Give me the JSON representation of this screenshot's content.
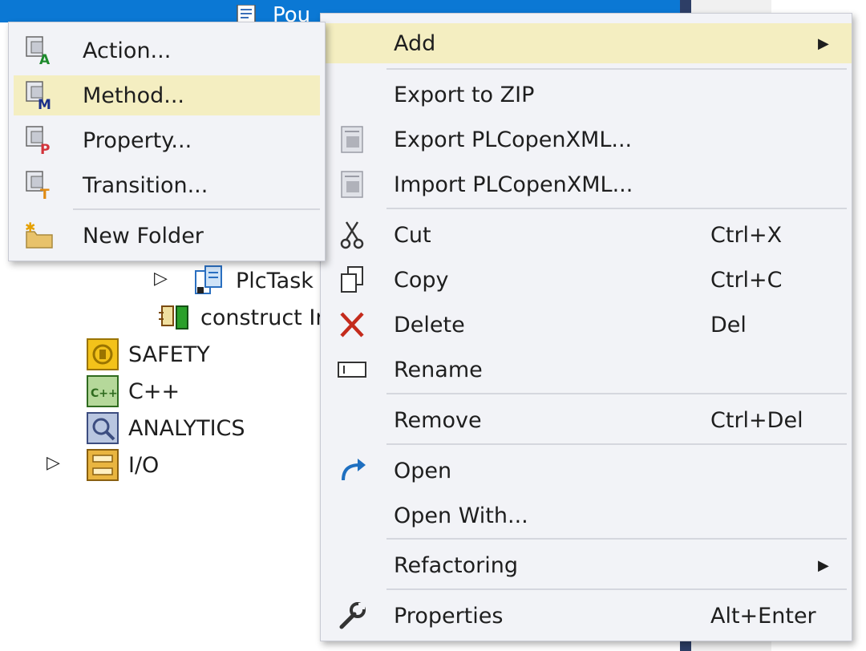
{
  "background": {
    "partial_title": "Pou",
    "colors": {
      "accent": "#0b78d4",
      "highlight": "#f4eec1",
      "menu_bg": "#f2f3f7"
    }
  },
  "tree": {
    "items": [
      {
        "label": "PlcTask",
        "icon": "task-icon",
        "expandable": true
      },
      {
        "label": "construct Ir",
        "icon": "construct-icon",
        "expandable": false
      },
      {
        "label": "SAFETY",
        "icon": "safety-icon",
        "expandable": false
      },
      {
        "label": "C++",
        "icon": "cpp-icon",
        "expandable": false
      },
      {
        "label": "ANALYTICS",
        "icon": "analytics-icon",
        "expandable": false
      },
      {
        "label": "I/O",
        "icon": "io-icon",
        "expandable": true
      }
    ]
  },
  "context_menu": {
    "items": [
      {
        "label": "Add",
        "shortcut": "",
        "icon": "",
        "submenu": true,
        "highlighted": true
      },
      {
        "label": "Export to ZIP",
        "shortcut": "",
        "icon": ""
      },
      {
        "label": "Export PLCopenXML...",
        "shortcut": "",
        "icon": "export-xml-icon"
      },
      {
        "label": "Import PLCopenXML...",
        "shortcut": "",
        "icon": "import-xml-icon"
      },
      {
        "label": "Cut",
        "shortcut": "Ctrl+X",
        "icon": "scissors-icon"
      },
      {
        "label": "Copy",
        "shortcut": "Ctrl+C",
        "icon": "copy-icon"
      },
      {
        "label": "Delete",
        "shortcut": "Del",
        "icon": "delete-x-icon"
      },
      {
        "label": "Rename",
        "shortcut": "",
        "icon": "rename-icon"
      },
      {
        "label": "Remove",
        "shortcut": "Ctrl+Del",
        "icon": ""
      },
      {
        "label": "Open",
        "shortcut": "",
        "icon": "open-arrow-icon"
      },
      {
        "label": "Open With...",
        "shortcut": "",
        "icon": ""
      },
      {
        "label": "Refactoring",
        "shortcut": "",
        "icon": "",
        "submenu": true
      },
      {
        "label": "Properties",
        "shortcut": "Alt+Enter",
        "icon": "wrench-icon"
      }
    ]
  },
  "add_submenu": {
    "items": [
      {
        "label": "Action...",
        "icon": "action-icon"
      },
      {
        "label": "Method...",
        "icon": "method-icon",
        "highlighted": true
      },
      {
        "label": "Property...",
        "icon": "property-icon"
      },
      {
        "label": "Transition...",
        "icon": "transition-icon"
      },
      {
        "label": "New Folder",
        "icon": "new-folder-icon"
      }
    ]
  }
}
